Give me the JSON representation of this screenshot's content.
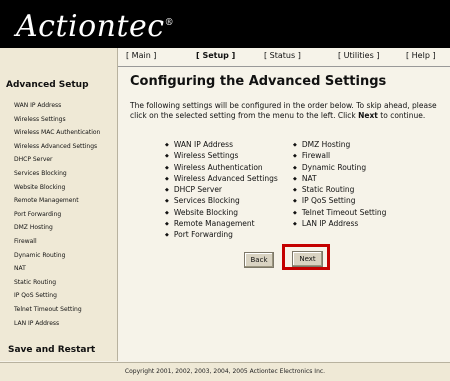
{
  "brand": {
    "logo_text": "Actiontec",
    "logo_mark": "®"
  },
  "nav": [
    {
      "label": "[ Main ]",
      "active": false
    },
    {
      "label": "[ Setup ]",
      "active": true
    },
    {
      "label": "[ Status ]",
      "active": false
    },
    {
      "label": "[ Utilities ]",
      "active": false
    },
    {
      "label": "[ Help ]",
      "active": false
    }
  ],
  "sidebar": {
    "heading": "Advanced Setup",
    "items": [
      "WAN IP Address",
      "Wireless Settings",
      "Wireless MAC Authentication",
      "Wireless Advanced Settings",
      "DHCP Server",
      "Services Blocking",
      "Website Blocking",
      "Remote Management",
      "Port Forwarding",
      "DMZ Hosting",
      "Firewall",
      "Dynamic Routing",
      "NAT",
      "Static Routing",
      "IP QoS Setting",
      "Telnet Timeout Setting",
      "LAN IP Address"
    ],
    "footer": "Save and Restart"
  },
  "main": {
    "title": "Configuring the Advanced Settings",
    "intro_before": "The following settings will be configured in the order below. To skip ahead, please click on the selected setting from the menu to the left. Click ",
    "intro_bold": "Next",
    "intro_after": " to continue.",
    "list_left": [
      "WAN IP Address",
      "Wireless Settings",
      "Wireless Authentication",
      "Wireless Advanced Settings",
      "DHCP Server",
      "Services Blocking",
      "Website Blocking",
      "Remote Management",
      "Port Forwarding"
    ],
    "list_right": [
      "DMZ Hosting",
      "Firewall",
      "Dynamic Routing",
      "NAT",
      "Static Routing",
      "IP QoS Setting",
      "Telnet Timeout Setting",
      "LAN IP Address"
    ],
    "back_label": "Back",
    "next_label": "Next",
    "highlight_color": "#c40000"
  },
  "footer": {
    "copyright": "Copyright 2001, 2002, 2003, 2004, 2005 Actiontec Electronics Inc."
  }
}
